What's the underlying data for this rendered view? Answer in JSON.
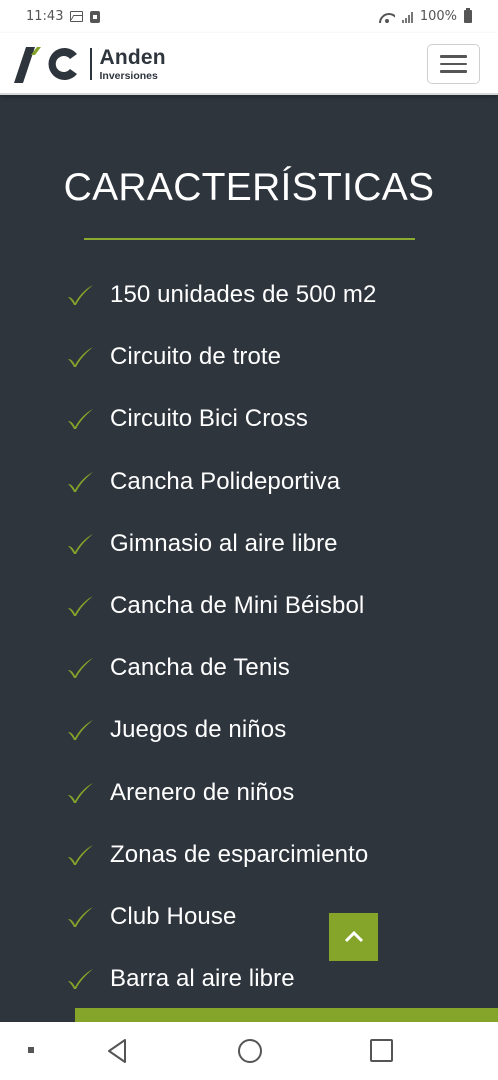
{
  "status_bar": {
    "time": "11:43",
    "battery": "100%"
  },
  "header": {
    "logo_name": "Anden",
    "logo_sub": "Inversiones",
    "brand_color": "#84a42a",
    "dark_color": "#2e353d"
  },
  "section": {
    "title": "CARACTERÍSTICAS",
    "features": [
      {
        "label": "150 unidades de 500 m2"
      },
      {
        "label": "Circuito de trote"
      },
      {
        "label": "Circuito Bici Cross"
      },
      {
        "label": "Cancha Polideportiva"
      },
      {
        "label": "Gimnasio al aire libre"
      },
      {
        "label": "Cancha de Mini Béisbol"
      },
      {
        "label": "Cancha de Tenis"
      },
      {
        "label": "Juegos de niños"
      },
      {
        "label": "Arenero de niños"
      },
      {
        "label": "Zonas de esparcimiento"
      },
      {
        "label": "Club House"
      },
      {
        "label": "Barra al aire libre"
      }
    ]
  },
  "icons": {
    "feature_bullet": "check-icon",
    "scroll_top": "chevron-up-icon",
    "menu": "hamburger-menu-icon"
  }
}
